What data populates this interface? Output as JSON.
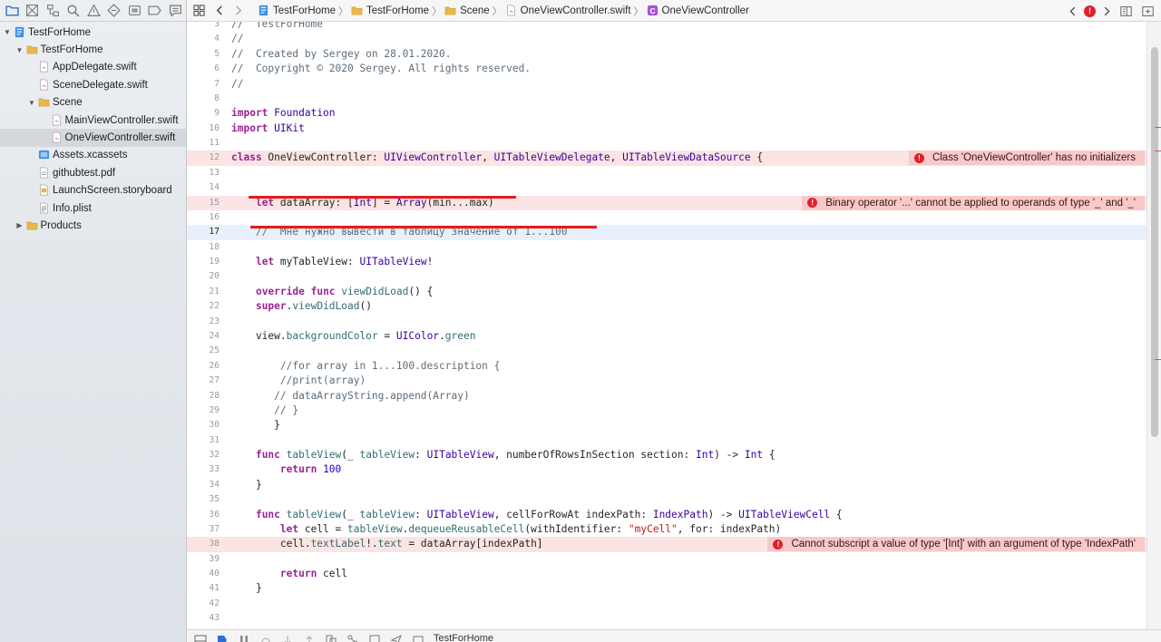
{
  "navigator": {
    "toolbar_icons": [
      "folder-icon",
      "source-control-icon",
      "hierarchy-icon",
      "search-icon",
      "warning-icon",
      "test-icon",
      "debug-icon",
      "breakpoint-icon",
      "report-icon"
    ],
    "tree": [
      {
        "label": "TestForHome",
        "icon": "project-icon",
        "depth": 0,
        "disclosure": "open"
      },
      {
        "label": "TestForHome",
        "icon": "folder-icon",
        "depth": 1,
        "disclosure": "open"
      },
      {
        "label": "AppDelegate.swift",
        "icon": "swift-file-icon",
        "depth": 2
      },
      {
        "label": "SceneDelegate.swift",
        "icon": "swift-file-icon",
        "depth": 2
      },
      {
        "label": "Scene",
        "icon": "folder-icon",
        "depth": 2,
        "disclosure": "open"
      },
      {
        "label": "MainViewController.swift",
        "icon": "swift-file-icon",
        "depth": 3
      },
      {
        "label": "OneViewController.swift",
        "icon": "swift-file-icon",
        "depth": 3,
        "selected": true
      },
      {
        "label": "Assets.xcassets",
        "icon": "assets-icon",
        "depth": 2
      },
      {
        "label": "githubtest.pdf",
        "icon": "pdf-file-icon",
        "depth": 2
      },
      {
        "label": "LaunchScreen.storyboard",
        "icon": "storyboard-icon",
        "depth": 2
      },
      {
        "label": "Info.plist",
        "icon": "plist-icon",
        "depth": 2
      },
      {
        "label": "Products",
        "icon": "folder-icon",
        "depth": 1,
        "disclosure": "closed"
      }
    ]
  },
  "jumpbar": {
    "crumbs": [
      {
        "label": "TestForHome",
        "icon": "project-icon"
      },
      {
        "label": "TestForHome",
        "icon": "folder-icon"
      },
      {
        "label": "Scene",
        "icon": "folder-icon"
      },
      {
        "label": "OneViewController.swift",
        "icon": "swift-file-icon"
      },
      {
        "label": "OneViewController",
        "icon": "class-icon"
      }
    ],
    "class_badge": "C",
    "error_indicator": "!"
  },
  "editor": {
    "lines": [
      {
        "n": "3",
        "code": "//  TestForHome"
      },
      {
        "n": "4",
        "code": "//"
      },
      {
        "n": "5",
        "code": "//  Created by Sergey on 28.01.2020."
      },
      {
        "n": "6",
        "code": "//  Copyright © 2020 Sergey. All rights reserved."
      },
      {
        "n": "7",
        "code": "//"
      },
      {
        "n": "8",
        "code": ""
      },
      {
        "n": "9",
        "code": "import Foundation"
      },
      {
        "n": "10",
        "code": "import UIKit"
      },
      {
        "n": "11",
        "code": ""
      },
      {
        "n": "12",
        "code": "class OneViewController: UIViewController, UITableViewDelegate, UITableViewDataSource {",
        "error": "Class 'OneViewController' has no initializers"
      },
      {
        "n": "13",
        "code": ""
      },
      {
        "n": "14",
        "code": ""
      },
      {
        "n": "15",
        "code": "    let dataArray: [Int] = Array(min...max)",
        "error": "Binary operator '...' cannot be applied to operands of type '_' and '_'"
      },
      {
        "n": "16",
        "code": ""
      },
      {
        "n": "17",
        "code": "    //  Мне нужно вывести в таблицу значение от 1...100",
        "current": true
      },
      {
        "n": "18",
        "code": ""
      },
      {
        "n": "19",
        "code": "    let myTableView: UITableView!"
      },
      {
        "n": "20",
        "code": ""
      },
      {
        "n": "21",
        "code": "    override func viewDidLoad() {"
      },
      {
        "n": "22",
        "code": "    super.viewDidLoad()"
      },
      {
        "n": "23",
        "code": ""
      },
      {
        "n": "24",
        "code": "    view.backgroundColor = UIColor.green"
      },
      {
        "n": "25",
        "code": ""
      },
      {
        "n": "26",
        "code": "        //for array in 1...100.description {"
      },
      {
        "n": "27",
        "code": "        //print(array)"
      },
      {
        "n": "28",
        "code": "       // dataArrayString.append(Array)"
      },
      {
        "n": "29",
        "code": "       // }"
      },
      {
        "n": "30",
        "code": "       }"
      },
      {
        "n": "31",
        "code": ""
      },
      {
        "n": "32",
        "code": "    func tableView(_ tableView: UITableView, numberOfRowsInSection section: Int) -> Int {"
      },
      {
        "n": "33",
        "code": "        return 100"
      },
      {
        "n": "34",
        "code": "    }"
      },
      {
        "n": "35",
        "code": ""
      },
      {
        "n": "36",
        "code": "    func tableView(_ tableView: UITableView, cellForRowAt indexPath: IndexPath) -> UITableViewCell {"
      },
      {
        "n": "37",
        "code": "        let cell = tableView.dequeueReusableCell(withIdentifier: \"myCell\", for: indexPath)"
      },
      {
        "n": "38",
        "code": "        cell.textLabel!.text = dataArray[indexPath]",
        "error": "Cannot subscript a value of type '[Int]' with an argument of type 'IndexPath'"
      },
      {
        "n": "39",
        "code": ""
      },
      {
        "n": "40",
        "code": "        return cell"
      },
      {
        "n": "41",
        "code": "    }"
      },
      {
        "n": "42",
        "code": ""
      },
      {
        "n": "43",
        "code": ""
      }
    ]
  },
  "debugbar": {
    "target": "TestForHome"
  },
  "colors": {
    "error_red": "#e0202a",
    "error_line_bg": "#fbe4e4",
    "error_badge_bg": "#f8c9c9",
    "current_line_bg": "#e8f1fb",
    "keyword": "#9b2393",
    "type": "#3900a0",
    "number": "#1c00cf",
    "string": "#c41a16",
    "comment": "#5d6c79"
  }
}
